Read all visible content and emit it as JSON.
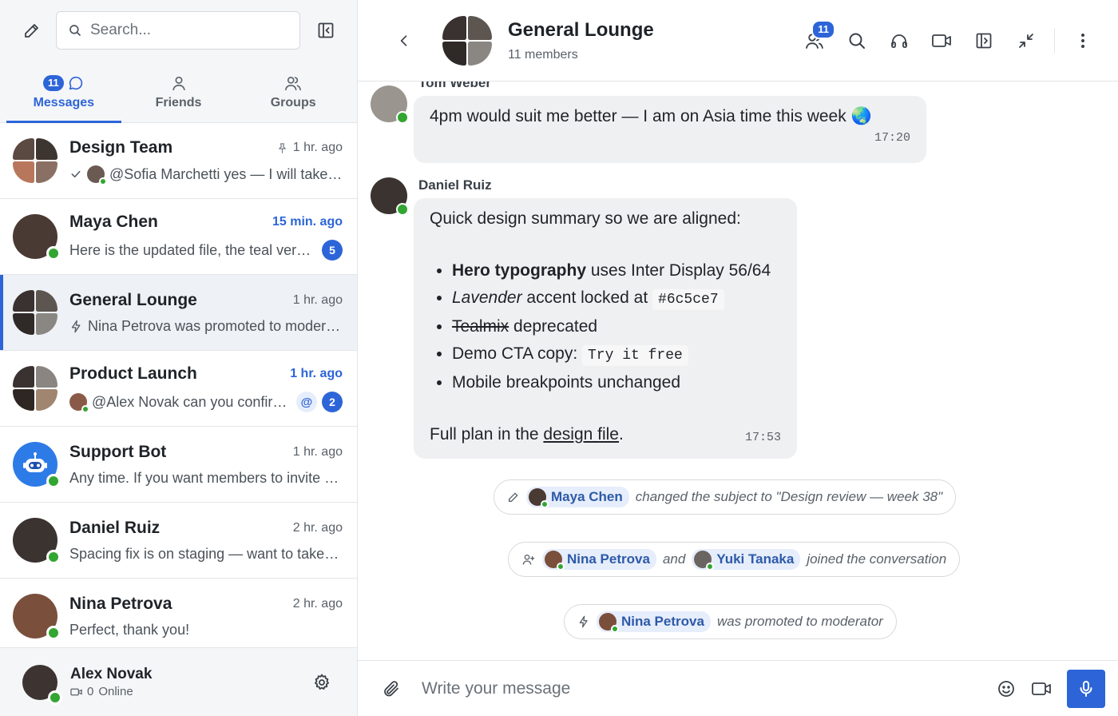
{
  "search": {
    "placeholder": "Search..."
  },
  "tabs": [
    {
      "label": "Messages",
      "badge": "11"
    },
    {
      "label": "Friends"
    },
    {
      "label": "Groups"
    }
  ],
  "conversations": [
    {
      "name": "Design Team",
      "time": "1 hr. ago",
      "preview": "@Sofia Marchetti yes — I will take a look",
      "pinned": true
    },
    {
      "name": "Maya Chen",
      "time": "15 min. ago",
      "preview": "Here is the updated file, the teal version",
      "unread": "5"
    },
    {
      "name": "General Lounge",
      "time": "1 hr. ago",
      "preview": "Nina Petrova was promoted to moderator"
    },
    {
      "name": "Product Launch",
      "time": "1 hr. ago",
      "preview": "@Alex Novak can you confirm the date",
      "mention": "@",
      "unread": "2"
    },
    {
      "name": "Support Bot",
      "time": "1 hr. ago",
      "preview": "Any time. If you want members to invite others"
    },
    {
      "name": "Daniel Ruiz",
      "time": "2 hr. ago",
      "preview": "Spacing fix is on staging — want to take a look?"
    },
    {
      "name": "Nina Petrova",
      "time": "2 hr. ago",
      "preview": "Perfect, thank you!"
    }
  ],
  "me": {
    "name": "Alex Novak",
    "count": "0",
    "status": "Online"
  },
  "chat": {
    "title": "General Lounge",
    "members": "11 members",
    "members_badge": "11"
  },
  "messages": [
    {
      "author": "Tom Weber",
      "text": "4pm would suit me better — I am on Asia time this week 🌏",
      "time": "17:20"
    },
    {
      "author": "Daniel Ruiz",
      "intro": "Quick design summary so we are aligned:",
      "bullets": {
        "b1_bold": "Hero typography",
        "b1_rest": " uses Inter Display 56/64",
        "b2_ital": "Lavender",
        "b2_rest": " accent locked at ",
        "b2_code": "#6c5ce7",
        "b3_strike": "Tealmix",
        "b3_rest": " deprecated",
        "b4_text": "Demo CTA copy: ",
        "b4_code": "Try it free",
        "b5_text": "Mobile breakpoints unchanged"
      },
      "outro": "Full plan in the ",
      "link": "design file",
      "period": ".",
      "time": "17:53"
    }
  ],
  "system": [
    {
      "user": "Maya Chen",
      "text": "changed the subject to \"Design review — week 38\""
    },
    {
      "user1": "Nina Petrova",
      "and": "and",
      "user2": "Yuki Tanaka",
      "text": "joined the conversation"
    },
    {
      "user": "Nina Petrova",
      "text": "was promoted to moderator"
    }
  ],
  "composer": {
    "placeholder": "Write your message"
  },
  "colors": {
    "accent": "#2d65d8",
    "online": "#33a532"
  }
}
